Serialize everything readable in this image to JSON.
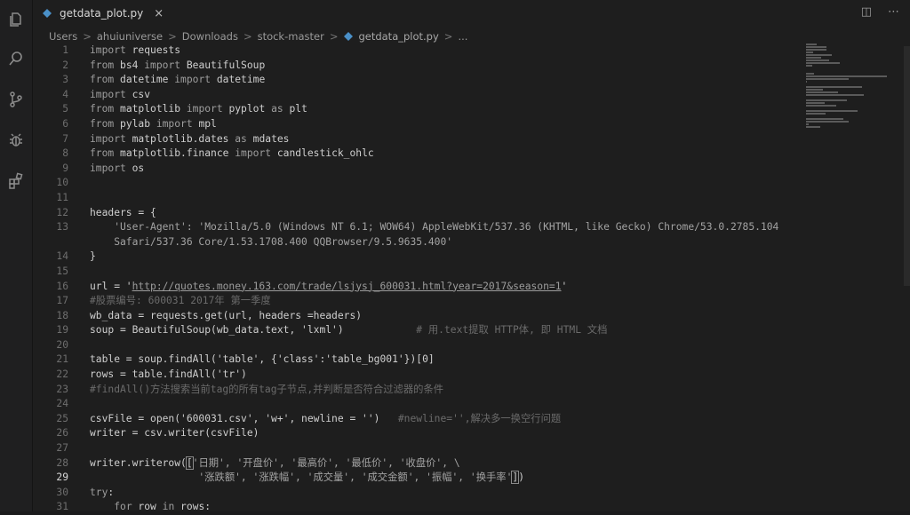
{
  "tab": {
    "title": "getdata_plot.py",
    "close_glyph": "×"
  },
  "breadcrumb": [
    "Users",
    "ahuiuniverse",
    "Downloads",
    "stock-master",
    "getdata_plot.py",
    "..."
  ],
  "editor": {
    "active_line": 29,
    "lines": [
      {
        "n": "1",
        "tokens": [
          {
            "t": "import",
            "c": "kw"
          },
          {
            "t": " requests"
          }
        ]
      },
      {
        "n": "2",
        "tokens": [
          {
            "t": "from",
            "c": "kw"
          },
          {
            "t": " bs4 "
          },
          {
            "t": "import",
            "c": "kw"
          },
          {
            "t": " BeautifulSoup"
          }
        ]
      },
      {
        "n": "3",
        "tokens": [
          {
            "t": "from",
            "c": "kw"
          },
          {
            "t": " datetime "
          },
          {
            "t": "import",
            "c": "kw"
          },
          {
            "t": " datetime"
          }
        ]
      },
      {
        "n": "4",
        "tokens": [
          {
            "t": "import",
            "c": "kw"
          },
          {
            "t": " csv"
          }
        ]
      },
      {
        "n": "5",
        "tokens": [
          {
            "t": "from",
            "c": "kw"
          },
          {
            "t": " matplotlib "
          },
          {
            "t": "import",
            "c": "kw"
          },
          {
            "t": " pyplot "
          },
          {
            "t": "as",
            "c": "kw"
          },
          {
            "t": " plt"
          }
        ]
      },
      {
        "n": "6",
        "tokens": [
          {
            "t": "from",
            "c": "kw"
          },
          {
            "t": " pylab "
          },
          {
            "t": "import",
            "c": "kw"
          },
          {
            "t": " mpl"
          }
        ]
      },
      {
        "n": "7",
        "tokens": [
          {
            "t": "import",
            "c": "kw"
          },
          {
            "t": " matplotlib.dates "
          },
          {
            "t": "as",
            "c": "kw"
          },
          {
            "t": " mdates"
          }
        ]
      },
      {
        "n": "8",
        "tokens": [
          {
            "t": "from",
            "c": "kw"
          },
          {
            "t": " matplotlib.finance "
          },
          {
            "t": "import",
            "c": "kw"
          },
          {
            "t": " candlestick_ohlc"
          }
        ]
      },
      {
        "n": "9",
        "tokens": [
          {
            "t": "import",
            "c": "kw"
          },
          {
            "t": " os"
          }
        ]
      },
      {
        "n": "10",
        "tokens": []
      },
      {
        "n": "11",
        "tokens": []
      },
      {
        "n": "12",
        "tokens": [
          {
            "t": "headers = {"
          }
        ]
      },
      {
        "n": "13",
        "tokens": [
          {
            "t": "    'User-Agent': 'Mozilla/5.0 (Windows NT 6.1; WOW64) AppleWebKit/537.36 (KHTML, like Gecko) Chrome/53.0.2785.104",
            "c": "str"
          }
        ]
      },
      {
        "n": "",
        "tokens": [
          {
            "t": "    Safari/537.36 Core/1.53.1708.400 QQBrowser/9.5.9635.400'",
            "c": "str"
          }
        ]
      },
      {
        "n": "14",
        "tokens": [
          {
            "t": "}"
          }
        ]
      },
      {
        "n": "15",
        "tokens": []
      },
      {
        "n": "16",
        "tokens": [
          {
            "t": "url = '"
          },
          {
            "t": "http://quotes.money.163.com/trade/lsjysj_600031.html?year=2017&season=1",
            "c": "url"
          },
          {
            "t": "'"
          }
        ]
      },
      {
        "n": "17",
        "tokens": [
          {
            "t": "#股票编号: 600031 2017年 第一季度",
            "c": "cm"
          }
        ]
      },
      {
        "n": "18",
        "tokens": [
          {
            "t": "wb_data = requests.get(url, headers =headers)"
          }
        ]
      },
      {
        "n": "19",
        "tokens": [
          {
            "t": "soup = BeautifulSoup(wb_data.text, 'lxml')            "
          },
          {
            "t": "# 用.text提取 HTTP体, 即 HTML 文档",
            "c": "cm"
          }
        ]
      },
      {
        "n": "20",
        "tokens": []
      },
      {
        "n": "21",
        "tokens": [
          {
            "t": "table = soup.findAll('table', {'class':'table_bg001'})[0]"
          }
        ]
      },
      {
        "n": "22",
        "tokens": [
          {
            "t": "rows = table.findAll('tr')"
          }
        ]
      },
      {
        "n": "23",
        "tokens": [
          {
            "t": "#findAll()方法搜索当前tag的所有tag子节点,并判断是否符合过滤器的条件",
            "c": "cm"
          }
        ]
      },
      {
        "n": "24",
        "tokens": []
      },
      {
        "n": "25",
        "tokens": [
          {
            "t": "csvFile = open('600031.csv', 'w+', newline = '')   "
          },
          {
            "t": "#newline='',解决多一换空行问题",
            "c": "cm"
          }
        ]
      },
      {
        "n": "26",
        "tokens": [
          {
            "t": "writer = csv.writer(csvFile)"
          }
        ]
      },
      {
        "n": "27",
        "tokens": []
      },
      {
        "n": "28",
        "tokens": [
          {
            "t": "writer.writerow("
          },
          {
            "t": "[",
            "c": "br"
          },
          {
            "t": "'日期', '开盘价', '最高价', '最低价', '收盘价', \\",
            "c": "str"
          }
        ]
      },
      {
        "n": "29",
        "tokens": [
          {
            "t": "                  '涨跌额', '涨跌幅', '成交量', '成交金额', '振幅', '换手率'",
            "c": "str"
          },
          {
            "t": "]",
            "c": "br"
          },
          {
            "t": ")"
          }
        ]
      },
      {
        "n": "30",
        "tokens": [
          {
            "t": "try",
            "c": "kw"
          },
          {
            "t": ":"
          }
        ]
      },
      {
        "n": "31",
        "tokens": [
          {
            "t": "    "
          },
          {
            "t": "for",
            "c": "kw"
          },
          {
            "t": " row "
          },
          {
            "t": "in",
            "c": "kw"
          },
          {
            "t": " rows:"
          }
        ]
      }
    ]
  },
  "icons": {
    "activity": [
      "files-icon",
      "search-icon",
      "source-control-icon",
      "debug-icon",
      "extensions-icon"
    ],
    "tab_actions": [
      "split-editor-icon",
      "more-actions-icon"
    ]
  },
  "colors": {
    "background": "#1e1e1e",
    "python_icon": "#4a90c8"
  }
}
